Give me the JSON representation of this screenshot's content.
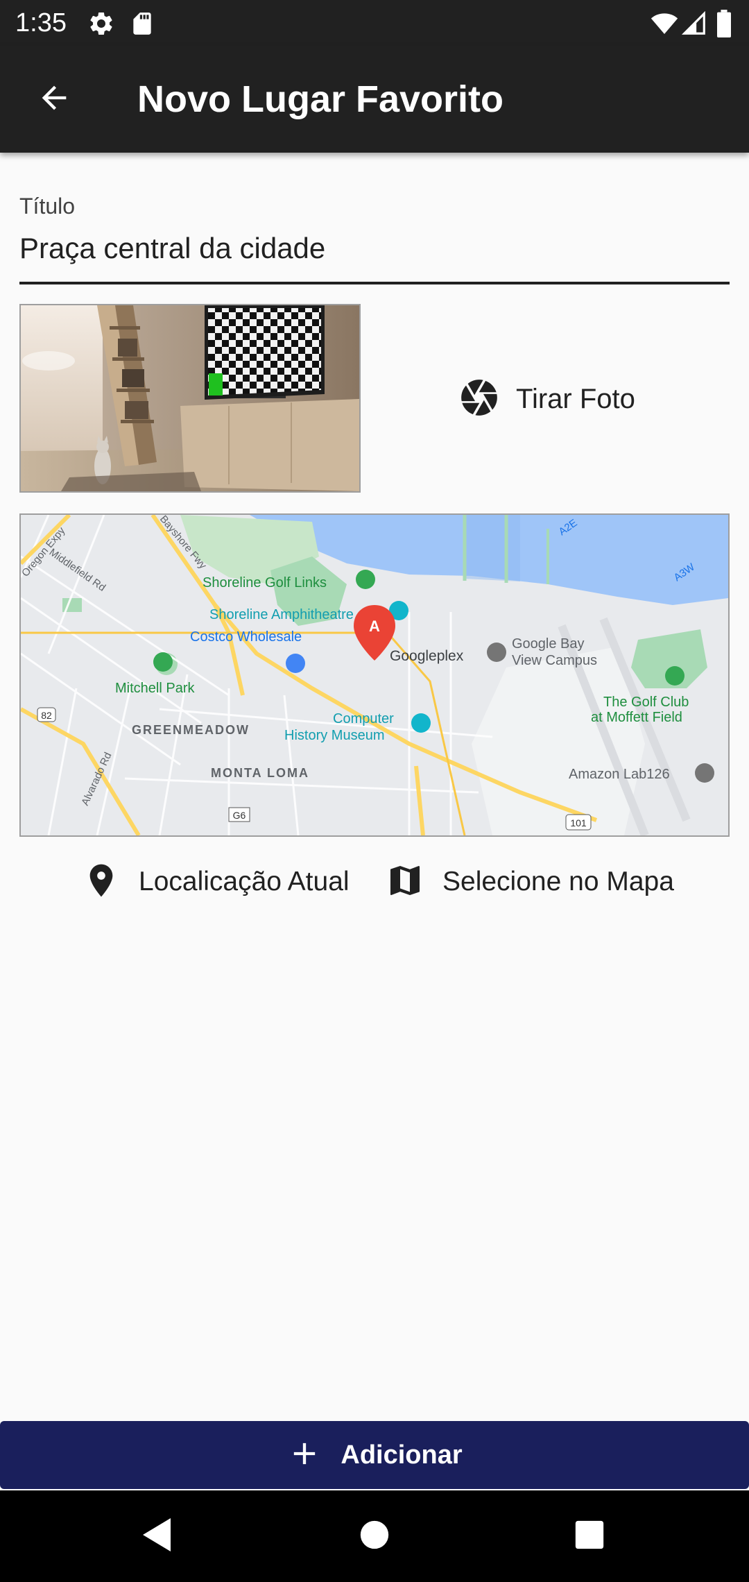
{
  "status_bar": {
    "time": "1:35",
    "icons": [
      "gear-icon",
      "sd-card-icon",
      "wifi-icon",
      "signal-icon",
      "battery-icon"
    ]
  },
  "app_bar": {
    "title": "Novo Lugar Favorito",
    "back_icon": "arrow-back-icon"
  },
  "form": {
    "title_field": {
      "label": "Título",
      "value": "Praça central da cidade"
    }
  },
  "photo": {
    "take_photo_label": "Tirar Foto",
    "icon": "camera-shutter-icon"
  },
  "map": {
    "labels": {
      "shoreline_golf": "Shoreline Golf Links",
      "shoreline_amph": "Shoreline Amphitheatre",
      "costco": "Costco Wholesale",
      "googleplex": "Googleplex",
      "google_bay": "Google Bay",
      "view_campus": "View Campus",
      "mitchell": "Mitchell Park",
      "greenmeadow": "GREENMEADOW",
      "computer": "Computer",
      "history_museum": "History Museum",
      "golf_club": "The Golf Club",
      "moffett": "at Moffett Field",
      "monta_loma": "MONTA LOMA",
      "amazon": "Amazon Lab126",
      "oregon": "Oregon Expy",
      "bayshore": "Bayshore Fwy",
      "middlefield": "Middlefield Rd",
      "alvarado": "Alvarado Rd",
      "a2e": "A2E",
      "a3w": "A3W",
      "r82": "82",
      "g6": "G6",
      "r101": "101",
      "marker": "A"
    }
  },
  "location_actions": {
    "current_location_label": "Localicação Atual",
    "select_on_map_label": "Selecione no Mapa"
  },
  "add_button": {
    "label": "Adicionar"
  },
  "colors": {
    "app_bar": "#212121",
    "background": "#fafafa",
    "add_button": "#1a1f5c",
    "map_water": "#9fc5f8",
    "map_park": "#a8dab5",
    "map_road": "#fdd663",
    "marker": "#ea4335"
  }
}
